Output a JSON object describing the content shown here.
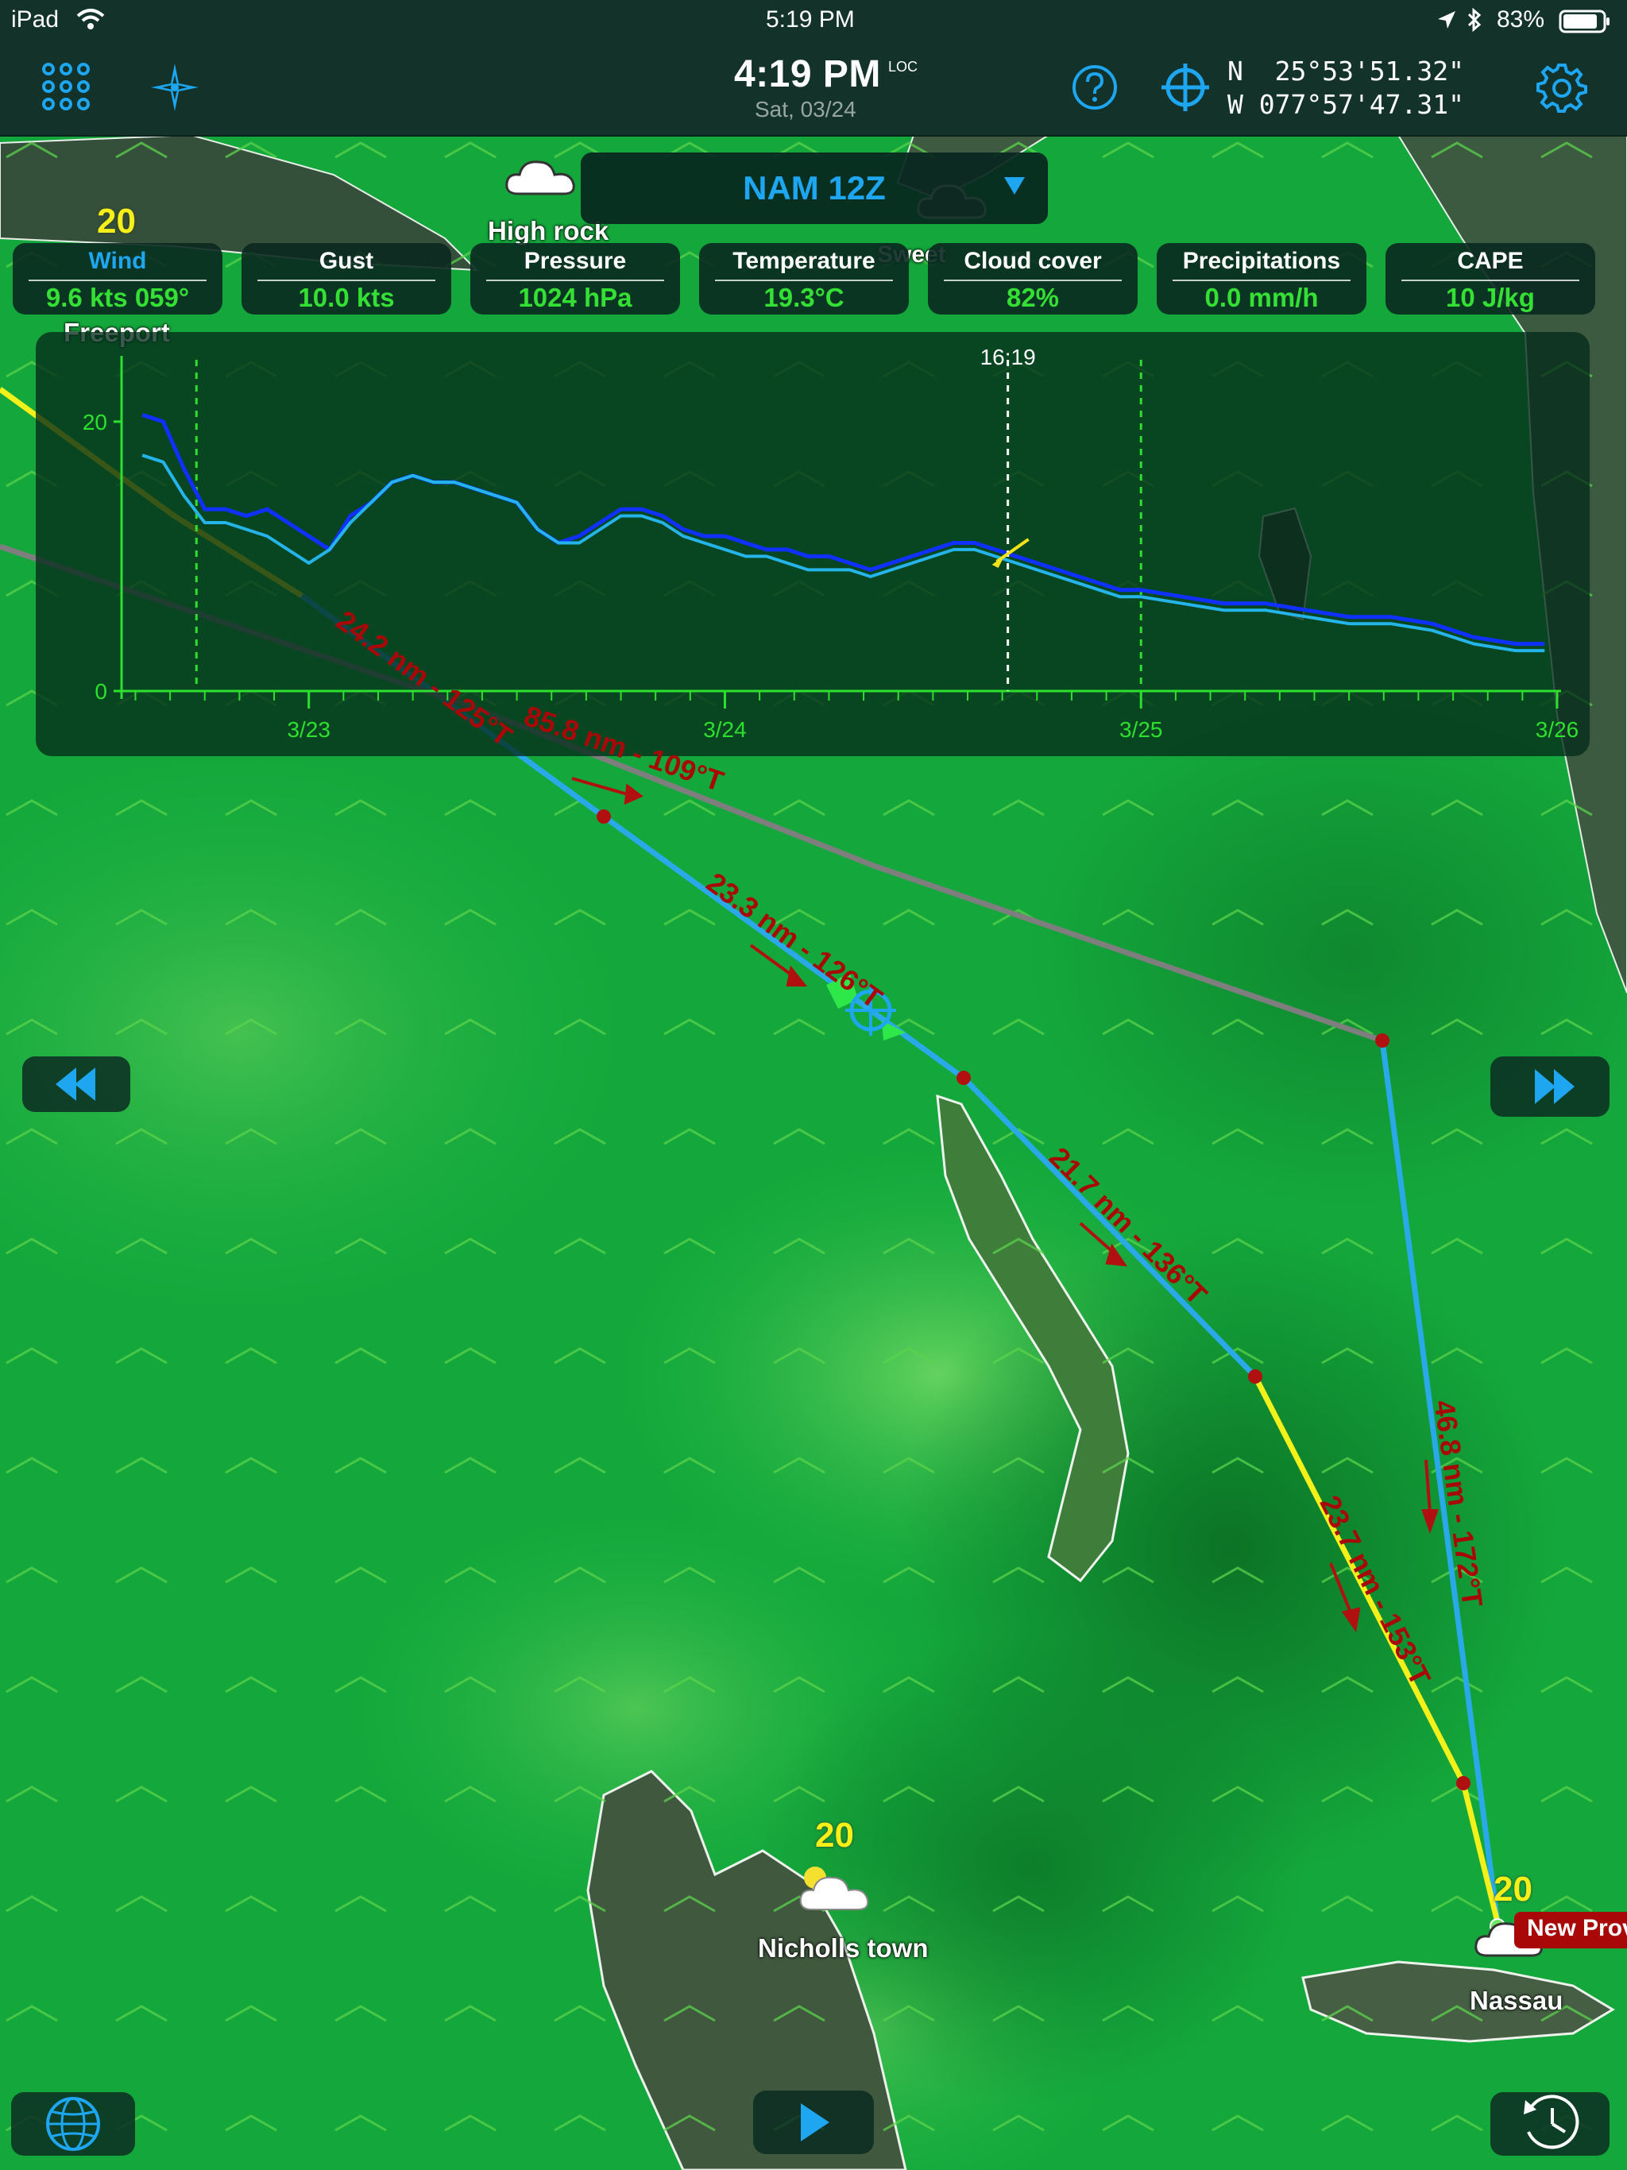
{
  "status_bar": {
    "device": "iPad",
    "time": "5:19 PM",
    "battery": "83%"
  },
  "toolbar": {
    "clock_time": "4:19 PM",
    "clock_tz": "LOC",
    "clock_date": "Sat, 03/24",
    "lat": "N  25°53'51.32\"",
    "lon": "W 077°57'47.31\""
  },
  "model": {
    "name": "NAM 12Z"
  },
  "params": [
    {
      "label": "Wind",
      "value": "9.6 kts 059°"
    },
    {
      "label": "Gust",
      "value": "10.0 kts"
    },
    {
      "label": "Pressure",
      "value": "1024 hPa"
    },
    {
      "label": "Temperature",
      "value": "19.3°C"
    },
    {
      "label": "Cloud cover",
      "value": "82%"
    },
    {
      "label": "Precipitations",
      "value": "0.0 mm/h"
    },
    {
      "label": "CAPE",
      "value": "10 J/kg"
    }
  ],
  "chart_data": {
    "type": "line",
    "cursor_label": "16:19",
    "x_ticks": [
      "3/23",
      "3/24",
      "3/25",
      "3/26"
    ],
    "y_ticks": [
      "0",
      "20"
    ],
    "ylim": [
      0,
      24
    ],
    "xlim": [
      -0.45,
      3.0
    ],
    "series": [
      {
        "color": "#1030ff",
        "x": [
          -0.4,
          -0.35,
          -0.3,
          -0.25,
          -0.2,
          -0.15,
          -0.1,
          -0.05,
          0,
          0.05,
          0.1,
          0.15,
          0.2,
          0.25,
          0.3,
          0.35,
          0.4,
          0.45,
          0.5,
          0.55,
          0.6,
          0.65,
          0.7,
          0.75,
          0.8,
          0.85,
          0.9,
          0.95,
          1,
          1.05,
          1.1,
          1.15,
          1.2,
          1.25,
          1.3,
          1.35,
          1.4,
          1.45,
          1.5,
          1.55,
          1.6,
          1.65,
          1.7,
          1.75,
          1.8,
          1.85,
          1.9,
          1.95,
          2,
          2.1,
          2.2,
          2.3,
          2.4,
          2.5,
          2.6,
          2.7,
          2.8,
          2.9,
          2.97
        ],
        "y": [
          20.5,
          20,
          16.5,
          13.5,
          13.5,
          13,
          13.5,
          12.5,
          11.5,
          10.5,
          13,
          14,
          15.5,
          16,
          15.5,
          15.5,
          15,
          14.5,
          14,
          12,
          11,
          11.5,
          12.5,
          13.5,
          13.5,
          13,
          12,
          11.5,
          11.5,
          11,
          10.5,
          10.5,
          10,
          10,
          9.5,
          9,
          9.5,
          10,
          10.5,
          11,
          11,
          10.5,
          10,
          9.5,
          9,
          8.5,
          8,
          7.5,
          7.5,
          7,
          6.5,
          6.5,
          6,
          5.5,
          5.5,
          5,
          4,
          3.5,
          3.5
        ]
      },
      {
        "color": "#25b4ea",
        "x": [
          -0.4,
          -0.35,
          -0.3,
          -0.25,
          -0.2,
          -0.15,
          -0.1,
          -0.05,
          0,
          0.05,
          0.1,
          0.15,
          0.2,
          0.25,
          0.3,
          0.35,
          0.4,
          0.45,
          0.5,
          0.55,
          0.6,
          0.65,
          0.7,
          0.75,
          0.8,
          0.85,
          0.9,
          0.95,
          1,
          1.05,
          1.1,
          1.15,
          1.2,
          1.25,
          1.3,
          1.35,
          1.4,
          1.45,
          1.5,
          1.55,
          1.6,
          1.65,
          1.7,
          1.75,
          1.8,
          1.85,
          1.9,
          1.95,
          2,
          2.1,
          2.2,
          2.3,
          2.4,
          2.5,
          2.6,
          2.7,
          2.8,
          2.9,
          2.97
        ],
        "y": [
          17.5,
          17,
          14.5,
          12.5,
          12.5,
          12,
          11.5,
          10.5,
          9.5,
          10.5,
          12.5,
          14,
          15.5,
          16,
          15.5,
          15.5,
          15,
          14.5,
          14,
          12,
          11,
          11,
          12,
          13,
          13,
          12.5,
          11.5,
          11,
          10.5,
          10,
          10,
          9.5,
          9,
          9,
          9,
          8.5,
          9,
          9.5,
          10,
          10.5,
          10.5,
          10,
          9.5,
          9,
          8.5,
          8,
          7.5,
          7,
          7,
          6.5,
          6,
          6,
          5.5,
          5,
          5,
          4.5,
          3.5,
          3,
          3
        ]
      }
    ]
  },
  "map": {
    "places": [
      "High rock",
      "Freeport",
      "Nicholls town",
      "Nassau",
      "Sweet"
    ],
    "wx_values": [
      "20",
      "20",
      "20"
    ],
    "legs": [
      "24.2 nm - 125°T",
      "85.8 nm - 109°T",
      "23.3 nm - 126°T",
      "21.7 nm - 136°T",
      "46.8 nm - 172°T",
      "23.7 nm - 153°T"
    ],
    "waypoint": "New Prov"
  },
  "colors": {
    "accent": "#1ea6f0",
    "value_green": "#35e035",
    "route_label": "#a80808",
    "route_blue": "#29a9e8",
    "route_yellow": "#f4f01a",
    "route_gray": "#7e7e7e"
  },
  "icons": [
    "wifi-icon",
    "location-arrow-icon",
    "bluetooth-icon",
    "battery-icon",
    "apps-grid-icon",
    "compass-star-icon",
    "help-icon",
    "crosshair-icon",
    "gear-icon",
    "rewind-icon",
    "fast-forward-icon",
    "globe-icon",
    "play-icon",
    "clock-history-icon",
    "cloud-icon",
    "sun-cloud-icon"
  ]
}
